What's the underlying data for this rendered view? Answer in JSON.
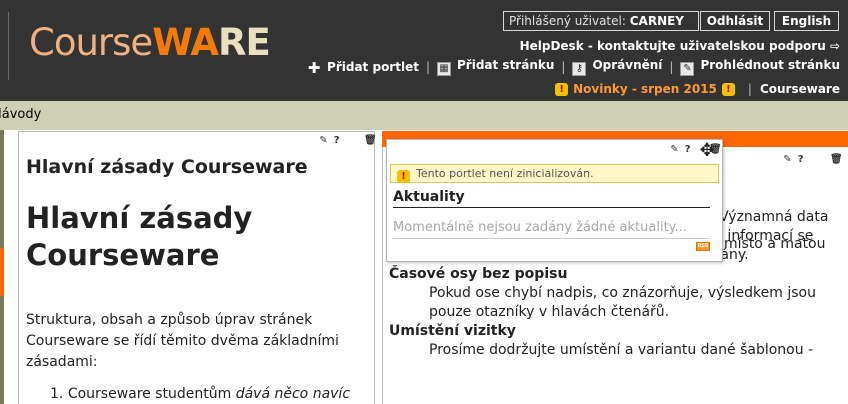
{
  "header": {
    "logo": {
      "part1": "Course",
      "part2": "WA",
      "part3": "RE"
    },
    "login_label": "Přihlášený uživatel:",
    "login_user": "CARNEY",
    "logout_label": "Odhlásit",
    "language_label": "English",
    "helpdesk_label": "HelpDesk - kontaktujte uživatelskou podporu",
    "helpdesk_icon": "⇨",
    "actions": [
      {
        "label": "Přidat portlet",
        "icon": "plus-icon"
      },
      {
        "label": "Přidat stránku",
        "icon": "page-icon"
      },
      {
        "label": "Oprávnění",
        "icon": "key-icon"
      },
      {
        "label": "Prohlédnout stránku",
        "icon": "pencil-icon"
      }
    ],
    "news_link": "Novinky - srpen 2015",
    "courseware_link": "Courseware"
  },
  "navbar": {
    "label": "Návody"
  },
  "left_portlet": {
    "title": "Hlavní zásady Courseware",
    "heading": "Hlavní zásady Courseware",
    "paragraph": "Struktura, obsah a způsob úprav stránek Courseware se řídí těmito dvěma základními zásadami:",
    "list_item_1_start": "Courseware studentům ",
    "list_item_1_em": "dává něco navíc"
  },
  "news_portlet": {
    "warning": "Tento portlet není zinicializován.",
    "title": "Aktuality",
    "empty_text": "Momentálně nejsou zadány žádné aktuality...",
    "rss_label": "RSS"
  },
  "right_portlet": {
    "frag_first": "místo a matou",
    "lines": [
      {
        "text": "čtenáře. Výjimkou jsou pouze Aktuality a Významná data",
        "type": "indent"
      },
      {
        "text": "v době založení předmětu, neboť u těchto informací se",
        "type": "indent"
      },
      {
        "text": "předpokládá, že budou průběžně doplňovány.",
        "type": "indent"
      },
      {
        "text": "Časové osy bez popisu",
        "type": "head"
      },
      {
        "text": "Pokud ose chybí nadpis, co znázorňuje, výsledkem jsou",
        "type": "indent"
      },
      {
        "text": "pouze otazníky v hlavách čtenářů.",
        "type": "indent"
      },
      {
        "text": "Umístění vizitky",
        "type": "head"
      },
      {
        "text": "Prosíme dodržujte umístění a variantu dané šablonou -",
        "type": "indent"
      }
    ]
  },
  "tools": {
    "edit": "✎",
    "help": "?",
    "delete": "🗑"
  }
}
